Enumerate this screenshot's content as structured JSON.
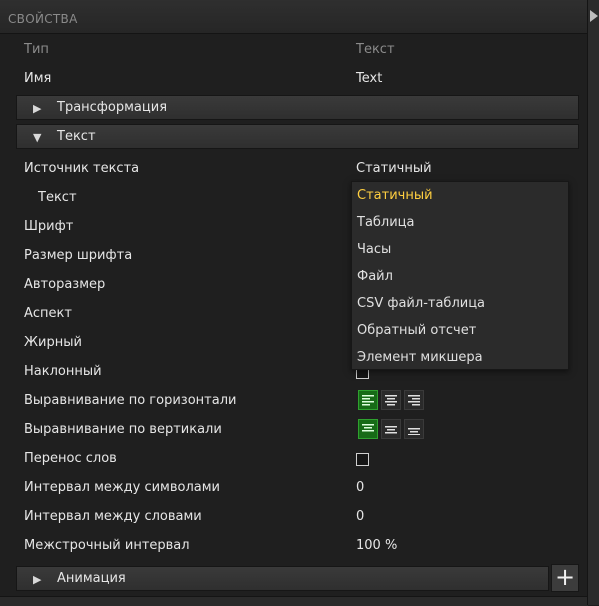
{
  "panel": {
    "title": "СВОЙСТВА"
  },
  "header_row": {
    "label": "Тип",
    "value": "Текст"
  },
  "name_row": {
    "label": "Имя",
    "value": "Text"
  },
  "sections": {
    "transform": "Трансформация",
    "text": "Текст",
    "animation": "Анимация"
  },
  "text_props": {
    "source": {
      "label": "Источник текста",
      "value": "Статичный"
    },
    "text": "Текст",
    "font": "Шрифт",
    "font_size": "Размер шрифта",
    "autosize": "Авторазмер",
    "aspect": "Аспект",
    "bold": "Жирный",
    "italic": "Наклонный",
    "halign": "Выравнивание по горизонтали",
    "valign": "Выравнивание по вертикали",
    "wordwrap": "Перенос слов",
    "letter_spacing": {
      "label": "Интервал между символами",
      "value": "0"
    },
    "word_spacing": {
      "label": "Интервал между словами",
      "value": "0"
    },
    "line_spacing": {
      "label": "Межстрочный интервал",
      "value": "100 %"
    }
  },
  "dropdown_options": [
    "Статичный",
    "Таблица",
    "Часы",
    "Файл",
    "CSV файл-таблица",
    "Обратный отсчет",
    "Элемент микшера"
  ],
  "dropdown_selected_index": 0,
  "halign_active": "left",
  "valign_active": "top",
  "colors": {
    "accent_selected": "#ffcf40",
    "active_button": "#176b17"
  },
  "add_button": "+"
}
